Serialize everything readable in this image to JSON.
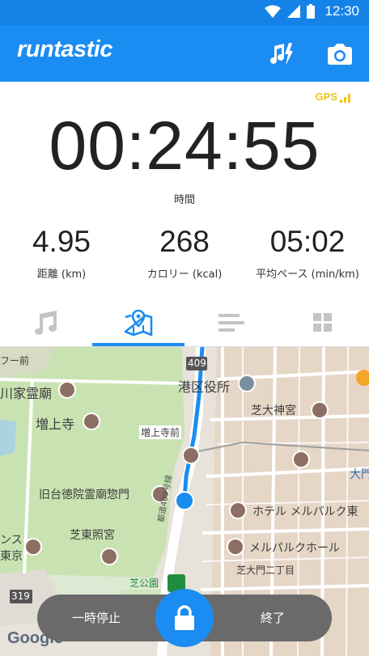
{
  "status_bar": {
    "time": "12:30"
  },
  "app": {
    "logo": "runtastic"
  },
  "gps": {
    "label": "GPS"
  },
  "timer": {
    "value": "00:24:55",
    "label": "時間"
  },
  "stats": [
    {
      "value": "4.95",
      "label": "距離 (km)"
    },
    {
      "value": "268",
      "label": "カロリー (kcal)"
    },
    {
      "value": "05:02",
      "label": "平均ペース (min/km)"
    }
  ],
  "tabs": [
    "music-tab",
    "map-tab",
    "stats-tab",
    "dashboard-tab"
  ],
  "map": {
    "labels": {
      "hall": "フー前",
      "kawaie": "川家霊廟",
      "zojoji": "増上寺",
      "zojoji_mae": "増上寺前",
      "minato": "港区役所",
      "shiba_shrine": "芝大神宮",
      "kyudai": "旧台徳院霊廟惣門",
      "shiba_tosho": "芝東照宮",
      "hotel": "ホテル メルパルク東",
      "melpark": "メルパルクホール",
      "shiba_daimon": "芝大門二丁目",
      "shiba_park": "芝公園",
      "route_409": "409",
      "route_319": "319",
      "big_letter": "大門",
      "hotel_left": "ンス",
      "tokyo_left": "東京",
      "road_vertical": "都道409号線"
    },
    "provider": "Google"
  },
  "controls": {
    "pause_label": "一時停止",
    "finish_label": "終了"
  }
}
